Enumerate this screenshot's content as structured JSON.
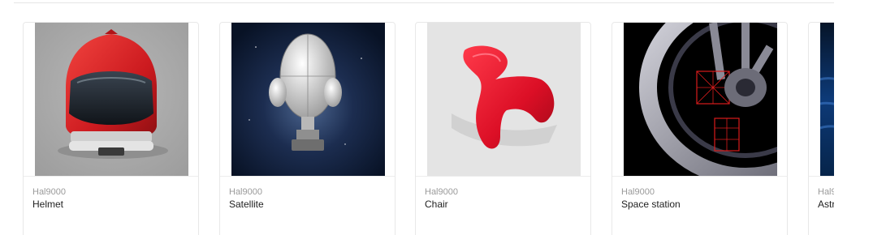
{
  "cards": [
    {
      "author": "Hal9000",
      "title": "Helmet",
      "thumb_bg": "#a9a9a9",
      "accent": "#d81f26"
    },
    {
      "author": "Hal9000",
      "title": "Satellite",
      "thumb_bg": "#0e1a33",
      "accent": "#c8c8c8"
    },
    {
      "author": "Hal9000",
      "title": "Chair",
      "thumb_bg": "#e6e6e6",
      "accent": "#e0192e"
    },
    {
      "author": "Hal9000",
      "title": "Space station",
      "thumb_bg": "#000000",
      "accent": "#c0c0c8"
    },
    {
      "author": "Hal9",
      "title": "Astr",
      "thumb_bg": "#0b2a55",
      "accent": "#1f5aa8"
    }
  ]
}
